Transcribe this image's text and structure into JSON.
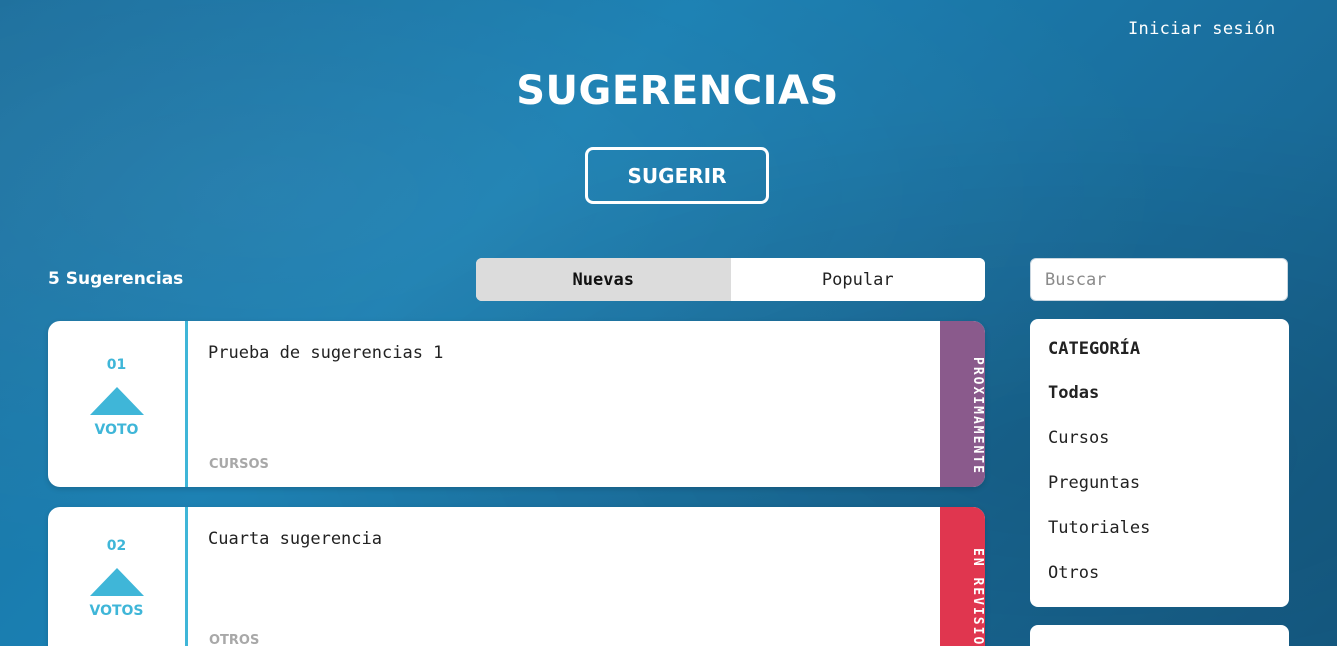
{
  "header": {
    "login_label": "Iniciar sesión",
    "title": "SUGERENCIAS",
    "suggest_label": "SUGERIR"
  },
  "toolbar": {
    "count_label": "5 Sugerencias",
    "tabs": [
      {
        "label": "Nuevas",
        "active": true
      },
      {
        "label": "Popular",
        "active": false
      }
    ]
  },
  "suggestions": [
    {
      "number": "01",
      "vote_label": "VOTO",
      "title": "Prueba de sugerencias 1",
      "category": "CURSOS",
      "status": "PROXIMAMENTE",
      "status_color": "#8a5a8c"
    },
    {
      "number": "02",
      "vote_label": "VOTOS",
      "title": "Cuarta sugerencia",
      "category": "OTROS",
      "status": "EN REVISIÓN",
      "status_color": "#e0364f"
    }
  ],
  "sidebar": {
    "search_placeholder": "Buscar",
    "category_heading": "CATEGORÍA",
    "categories": [
      {
        "label": "Todas",
        "active": true
      },
      {
        "label": "Cursos",
        "active": false
      },
      {
        "label": "Preguntas",
        "active": false
      },
      {
        "label": "Tutoriales",
        "active": false
      },
      {
        "label": "Otros",
        "active": false
      }
    ]
  },
  "colors": {
    "accent": "#3fb6d8",
    "background": "#1a7fb2"
  }
}
